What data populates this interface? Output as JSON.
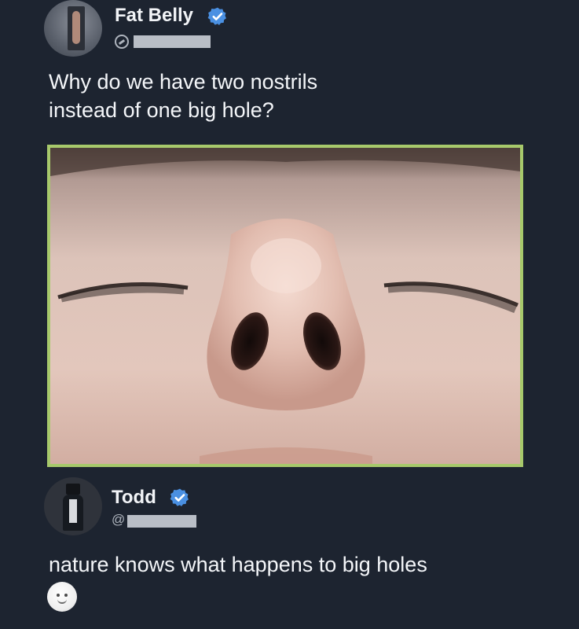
{
  "posts": [
    {
      "author": {
        "display_name": "Fat Belly",
        "verified": true
      },
      "text_lines": [
        "Why do we have two nostrils",
        "instead of one big hole?"
      ]
    },
    {
      "author": {
        "display_name": "Todd",
        "verified": true,
        "handle_prefix": "@"
      },
      "text": "nature knows what happens to big holes"
    }
  ],
  "colors": {
    "background": "#1d2430",
    "verified_badge": "#4a90e2",
    "photo_border": "#a7c96b",
    "text": "#f4f6f9",
    "redaction": "#b9bec6"
  },
  "icons": {
    "verified": "verified-badge-icon",
    "handle_mark": "handle-link-icon",
    "reaction": "slightly-smiling-face-icon"
  }
}
